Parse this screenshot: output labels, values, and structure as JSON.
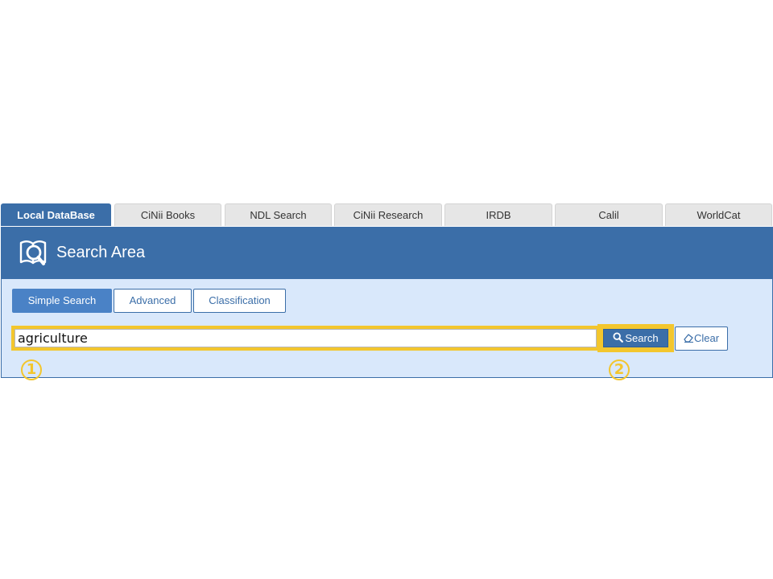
{
  "tabs": [
    {
      "label": "Local DataBase",
      "active": true
    },
    {
      "label": "CiNii Books",
      "active": false
    },
    {
      "label": "NDL Search",
      "active": false
    },
    {
      "label": "CiNii Research",
      "active": false
    },
    {
      "label": "IRDB",
      "active": false
    },
    {
      "label": "Calil",
      "active": false
    },
    {
      "label": "WorldCat",
      "active": false
    }
  ],
  "header": {
    "title": "Search Area",
    "icon": "book-search-icon"
  },
  "search_modes": [
    {
      "label": "Simple Search",
      "active": true
    },
    {
      "label": "Advanced",
      "active": false
    },
    {
      "label": "Classification",
      "active": false
    }
  ],
  "search": {
    "value": "agriculture",
    "button_label": "Search",
    "button_icon": "search-icon",
    "clear_label": "Clear",
    "clear_icon": "eraser-icon"
  },
  "annotations": [
    {
      "label": "1"
    },
    {
      "label": "2"
    }
  ],
  "colors": {
    "primary": "#3b6ea8",
    "panel_bg": "#d9e8fb",
    "highlight": "#f3c62d",
    "tab_inactive": "#e6e6e6"
  }
}
